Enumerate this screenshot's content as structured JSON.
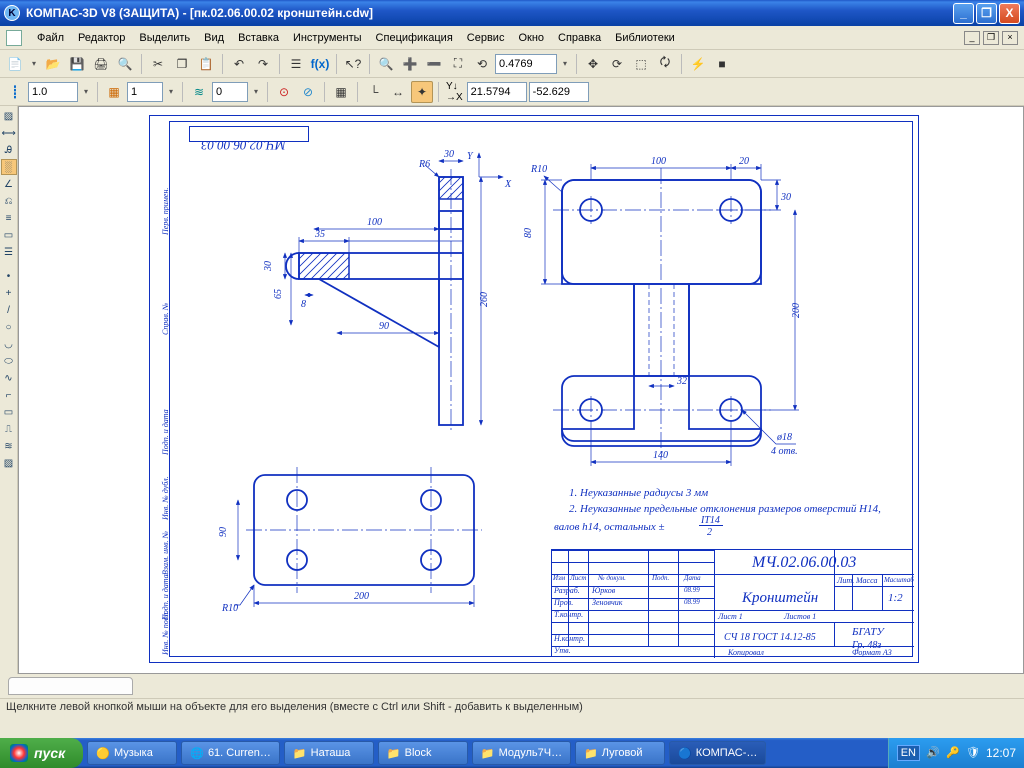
{
  "window": {
    "title": "КОМПАС-3D V8 (ЗАЩИТА) - [пк.02.06.00.02 кронштейн.cdw]",
    "min": "_",
    "max": "❐",
    "close": "X"
  },
  "menu": {
    "file": "Файл",
    "editor": "Редактор",
    "select": "Выделить",
    "view": "Вид",
    "insert": "Вставка",
    "tools": "Инструменты",
    "spec": "Спецификация",
    "service": "Сервис",
    "window": "Окно",
    "help": "Справка",
    "libs": "Библиотеки"
  },
  "toolbar1": {
    "zoom_value": "0.4769"
  },
  "toolbar2": {
    "val1": "1.0",
    "val2": "1",
    "val3": "0",
    "coord_x": "21.5794",
    "coord_y": "-52.629"
  },
  "drawing": {
    "topcode": "МЧ.02.06.00.03",
    "dims": {
      "r6": "R6",
      "r10a": "R10",
      "r10b": "R10",
      "d30a": "30",
      "d100a": "100",
      "d20": "20",
      "d30b": "30",
      "d80": "80",
      "d200": "200",
      "d32": "32",
      "d140": "140",
      "phi18": "ø18",
      "holes": "4 отв.",
      "d35": "35",
      "d100b": "100",
      "d30c": "30",
      "d8": "8",
      "d65": "65",
      "d90a": "90",
      "d260": "260",
      "d90b": "90",
      "d200b": "200"
    },
    "notes": {
      "n1": "1. Неуказанные радиусы 3 мм",
      "n2": "2. Неуказанные предельные отклонения размеров отверстий H14,",
      "n2b": "валов h14, остальных ±",
      "n2c": "IT14",
      "n2d": "2"
    },
    "titleblock": {
      "code": "МЧ.02.06.00.03",
      "name": "Кронштейн",
      "material": "СЧ 18 ГОСТ 14.12-85",
      "lit": "Лит.",
      "mass": "Масса",
      "scale": "Масштаб",
      "massval": "1:2",
      "sheet": "Лист 1",
      "sheets": "Листов 1",
      "org": "БГАТУ",
      "group": "Гр. 48з",
      "format": "Формат   А3",
      "kopir": "Копировал",
      "rows": [
        "Изм",
        "Лист",
        "№ докум.",
        "Подп.",
        "Дата"
      ],
      "roles": [
        "Разраб.",
        "Пров.",
        "Т.контр.",
        "",
        "Н.контр.",
        "Утв."
      ],
      "surnames": [
        "Юрков",
        "Зеновчик",
        "",
        "",
        "",
        ""
      ],
      "dates": "08.99",
      "date2": "08.99"
    },
    "side": {
      "t1": "Перв. примен.",
      "t2": "Справ. №",
      "t3": "Подп. и дата",
      "t4": "Инв. № дубл.",
      "t5": "Взам. инв. №",
      "t6": "Подп. и дата",
      "t7": "Инв. № подл."
    }
  },
  "status": {
    "text": "Щелкните левой кнопкой мыши на объекте для его выделения (вместе с Ctrl или Shift - добавить к выделенным)"
  },
  "taskbar": {
    "start": "пуск",
    "items": [
      "Музыка",
      "61. Curren…",
      "Наташа",
      "Block",
      "Модуль7Ч…",
      "Луговой",
      "КОМПАС-…"
    ],
    "lang": "EN",
    "clock": "12:07"
  }
}
